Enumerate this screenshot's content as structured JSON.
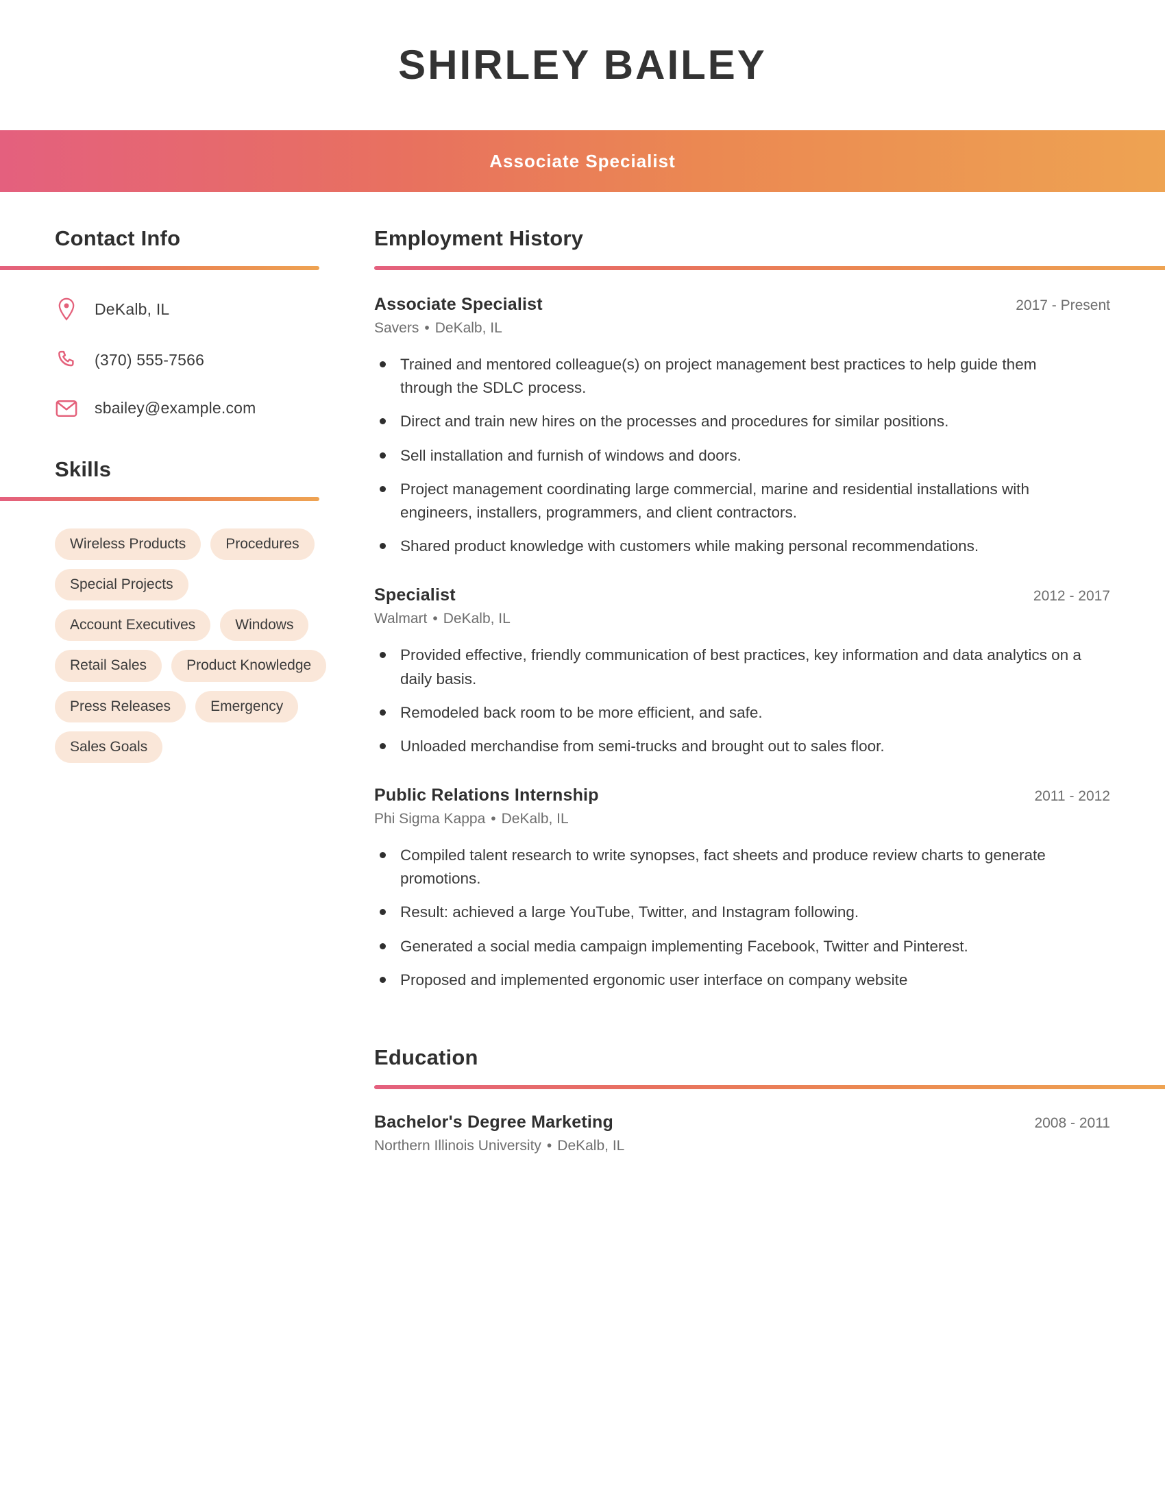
{
  "theme": {
    "gradient_start": "#e4607e",
    "gradient_end": "#eea352",
    "chip_background": "#fae7d9",
    "heading_color": "#2f2f2f",
    "muted_text": "#6e6e6e"
  },
  "header": {
    "name": "SHIRLEY BAILEY",
    "job_title": "Associate Specialist"
  },
  "sidebar": {
    "contact": {
      "heading": "Contact Info",
      "items": [
        {
          "icon": "location-pin-icon",
          "value": "DeKalb, IL"
        },
        {
          "icon": "phone-icon",
          "value": "(370) 555-7566"
        },
        {
          "icon": "email-envelope-icon",
          "value": "sbailey@example.com"
        }
      ]
    },
    "skills": {
      "heading": "Skills",
      "items": [
        "Wireless Products",
        "Procedures",
        "Special Projects",
        "Account Executives",
        "Windows",
        "Retail Sales",
        "Product Knowledge",
        "Press Releases",
        "Emergency",
        "Sales Goals"
      ]
    }
  },
  "main": {
    "employment": {
      "heading": "Employment History",
      "entries": [
        {
          "role": "Associate Specialist",
          "dates": "2017 - Present",
          "company": "Savers",
          "location": "DeKalb, IL",
          "bullets": [
            "Trained and mentored colleague(s) on project management best practices to help guide them through the SDLC process.",
            "Direct and train new hires on the processes and procedures for similar positions.",
            "Sell installation and furnish of windows and doors.",
            "Project management coordinating large commercial, marine and residential installations with engineers, installers, programmers, and client contractors.",
            "Shared product knowledge with customers while making personal recommendations."
          ]
        },
        {
          "role": "Specialist",
          "dates": "2012 - 2017",
          "company": "Walmart",
          "location": "DeKalb, IL",
          "bullets": [
            "Provided effective, friendly communication of best practices, key information and data analytics on a daily basis.",
            "Remodeled back room to be more efficient, and safe.",
            "Unloaded merchandise from semi-trucks and brought out to sales floor."
          ]
        },
        {
          "role": "Public Relations Internship",
          "dates": "2011 - 2012",
          "company": "Phi Sigma Kappa",
          "location": "DeKalb, IL",
          "bullets": [
            "Compiled talent research to write synopses, fact sheets and produce review charts to generate promotions.",
            "Result: achieved a large YouTube, Twitter, and Instagram following.",
            "Generated a social media campaign implementing Facebook, Twitter and Pinterest.",
            "Proposed and implemented ergonomic user interface on company website"
          ]
        }
      ]
    },
    "education": {
      "heading": "Education",
      "entries": [
        {
          "role": "Bachelor's Degree Marketing",
          "dates": "2008 - 2011",
          "company": "Northern Illinois University",
          "location": "DeKalb, IL",
          "bullets": []
        }
      ]
    },
    "separator": "•"
  }
}
